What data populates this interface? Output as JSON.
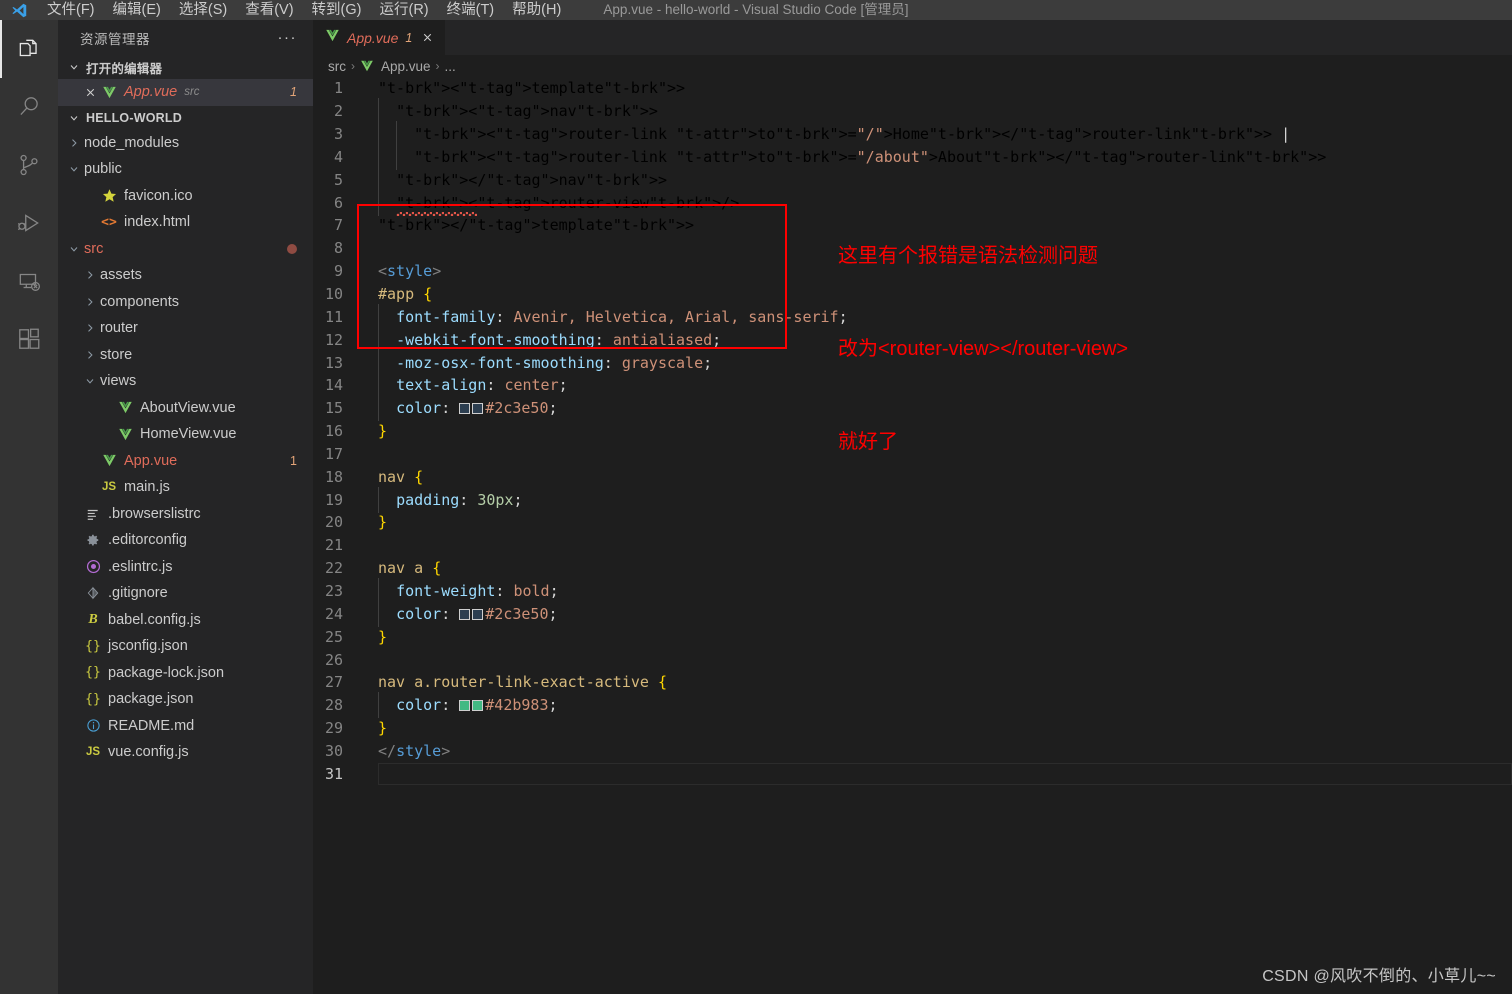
{
  "window": {
    "title": "App.vue - hello-world - Visual Studio Code [管理员]",
    "logo_icon": "vscode-logo-icon"
  },
  "menubar": {
    "items": [
      {
        "label": "文件(F)",
        "name": "menu-file"
      },
      {
        "label": "编辑(E)",
        "name": "menu-edit"
      },
      {
        "label": "选择(S)",
        "name": "menu-selection"
      },
      {
        "label": "查看(V)",
        "name": "menu-view"
      },
      {
        "label": "转到(G)",
        "name": "menu-go"
      },
      {
        "label": "运行(R)",
        "name": "menu-run"
      },
      {
        "label": "终端(T)",
        "name": "menu-terminal"
      },
      {
        "label": "帮助(H)",
        "name": "menu-help"
      }
    ]
  },
  "activitybar": {
    "items": [
      {
        "icon": "explorer-icon",
        "active": true
      },
      {
        "icon": "search-icon",
        "active": false
      },
      {
        "icon": "source-control-icon",
        "active": false
      },
      {
        "icon": "run-and-debug-icon",
        "active": false
      },
      {
        "icon": "remote-explorer-icon",
        "active": false
      },
      {
        "icon": "extensions-icon",
        "active": false
      }
    ]
  },
  "sidebar": {
    "title": "资源管理器",
    "more_actions": "···",
    "open_editors": {
      "label": "打开的编辑器",
      "expanded": true,
      "items": [
        {
          "name": "App.vue",
          "folder": "src",
          "badge": "1",
          "icon": "vue-icon",
          "selected": true,
          "close": "×"
        }
      ]
    },
    "workspace": {
      "label": "HELLO-WORLD",
      "expanded": true,
      "items": [
        {
          "label": "node_modules",
          "type": "folder",
          "expanded": false,
          "indent": 1
        },
        {
          "label": "public",
          "type": "folder",
          "expanded": true,
          "indent": 1
        },
        {
          "label": "favicon.ico",
          "type": "file",
          "icon": "star-icon",
          "indent": 2
        },
        {
          "label": "index.html",
          "type": "file",
          "icon": "html-icon",
          "indent": 2
        },
        {
          "label": "src",
          "type": "folder",
          "expanded": true,
          "indent": 1,
          "modified": true,
          "color": "#e06c5a"
        },
        {
          "label": "assets",
          "type": "folder",
          "expanded": false,
          "indent": 2
        },
        {
          "label": "components",
          "type": "folder",
          "expanded": false,
          "indent": 2
        },
        {
          "label": "router",
          "type": "folder",
          "expanded": false,
          "indent": 2
        },
        {
          "label": "store",
          "type": "folder",
          "expanded": false,
          "indent": 2
        },
        {
          "label": "views",
          "type": "folder",
          "expanded": true,
          "indent": 2
        },
        {
          "label": "AboutView.vue",
          "type": "file",
          "icon": "vue-icon",
          "indent": 3
        },
        {
          "label": "HomeView.vue",
          "type": "file",
          "icon": "vue-icon",
          "indent": 3
        },
        {
          "label": "App.vue",
          "type": "file",
          "icon": "vue-icon",
          "indent": 2,
          "badge": "1",
          "color": "#e06c5a"
        },
        {
          "label": "main.js",
          "type": "file",
          "icon": "js-icon",
          "indent": 2
        },
        {
          "label": ".browserslistrc",
          "type": "file",
          "icon": "list-icon",
          "indent": 1
        },
        {
          "label": ".editorconfig",
          "type": "file",
          "icon": "gear-icon",
          "indent": 1
        },
        {
          "label": ".eslintrc.js",
          "type": "file",
          "icon": "eslint-icon",
          "indent": 1
        },
        {
          "label": ".gitignore",
          "type": "file",
          "icon": "git-icon",
          "indent": 1
        },
        {
          "label": "babel.config.js",
          "type": "file",
          "icon": "babel-icon",
          "indent": 1
        },
        {
          "label": "jsconfig.json",
          "type": "file",
          "icon": "json-icon",
          "indent": 1
        },
        {
          "label": "package-lock.json",
          "type": "file",
          "icon": "json-icon",
          "indent": 1
        },
        {
          "label": "package.json",
          "type": "file",
          "icon": "json-icon",
          "indent": 1
        },
        {
          "label": "README.md",
          "type": "file",
          "icon": "info-icon",
          "indent": 1
        },
        {
          "label": "vue.config.js",
          "type": "file",
          "icon": "js-icon",
          "indent": 1
        }
      ]
    }
  },
  "editor": {
    "tabs": [
      {
        "label": "App.vue",
        "badge": "1",
        "close": "×",
        "icon": "vue-icon",
        "active": true
      }
    ],
    "breadcrumb": [
      {
        "label": "src",
        "icon": null
      },
      {
        "label": "App.vue",
        "icon": "vue-icon"
      },
      {
        "label": "...",
        "icon": null
      }
    ],
    "breadcrumb_sep": "›",
    "line_count": 31,
    "first_line": 1,
    "code_lines": [
      "<template>",
      "  <nav>",
      "    <router-link to=\"/\">Home</router-link> |",
      "    <router-link to=\"/about\">About</router-link>",
      "  </nav>",
      "  <router-view/>",
      "</template>",
      "",
      "<style>",
      "#app {",
      "  font-family: Avenir, Helvetica, Arial, sans-serif;",
      "  -webkit-font-smoothing: antialiased;",
      "  -moz-osx-font-smoothing: grayscale;",
      "  text-align: center;",
      "  color: #2c3e50;",
      "}",
      "",
      "nav {",
      "  padding: 30px;",
      "}",
      "",
      "nav a {",
      "  font-weight: bold;",
      "  color: #2c3e50;",
      "}",
      "",
      "nav a.router-link-exact-active {",
      "  color: #42b983;",
      "}",
      "</style>",
      ""
    ],
    "color_swatches": [
      {
        "line": 15,
        "value": "#2c3e50"
      },
      {
        "line": 24,
        "value": "#2c3e50"
      },
      {
        "line": 28,
        "value": "#42b983"
      }
    ],
    "error_squiggle_line": 6
  },
  "annotations": {
    "box_color": "#ff0000",
    "text_color": "#ff0000",
    "lines": [
      "这里有个报错是语法检测问题",
      "改为<router-view></router-view>",
      "就好了"
    ]
  },
  "watermark": "CSDN @风吹不倒的、小草儿~~"
}
